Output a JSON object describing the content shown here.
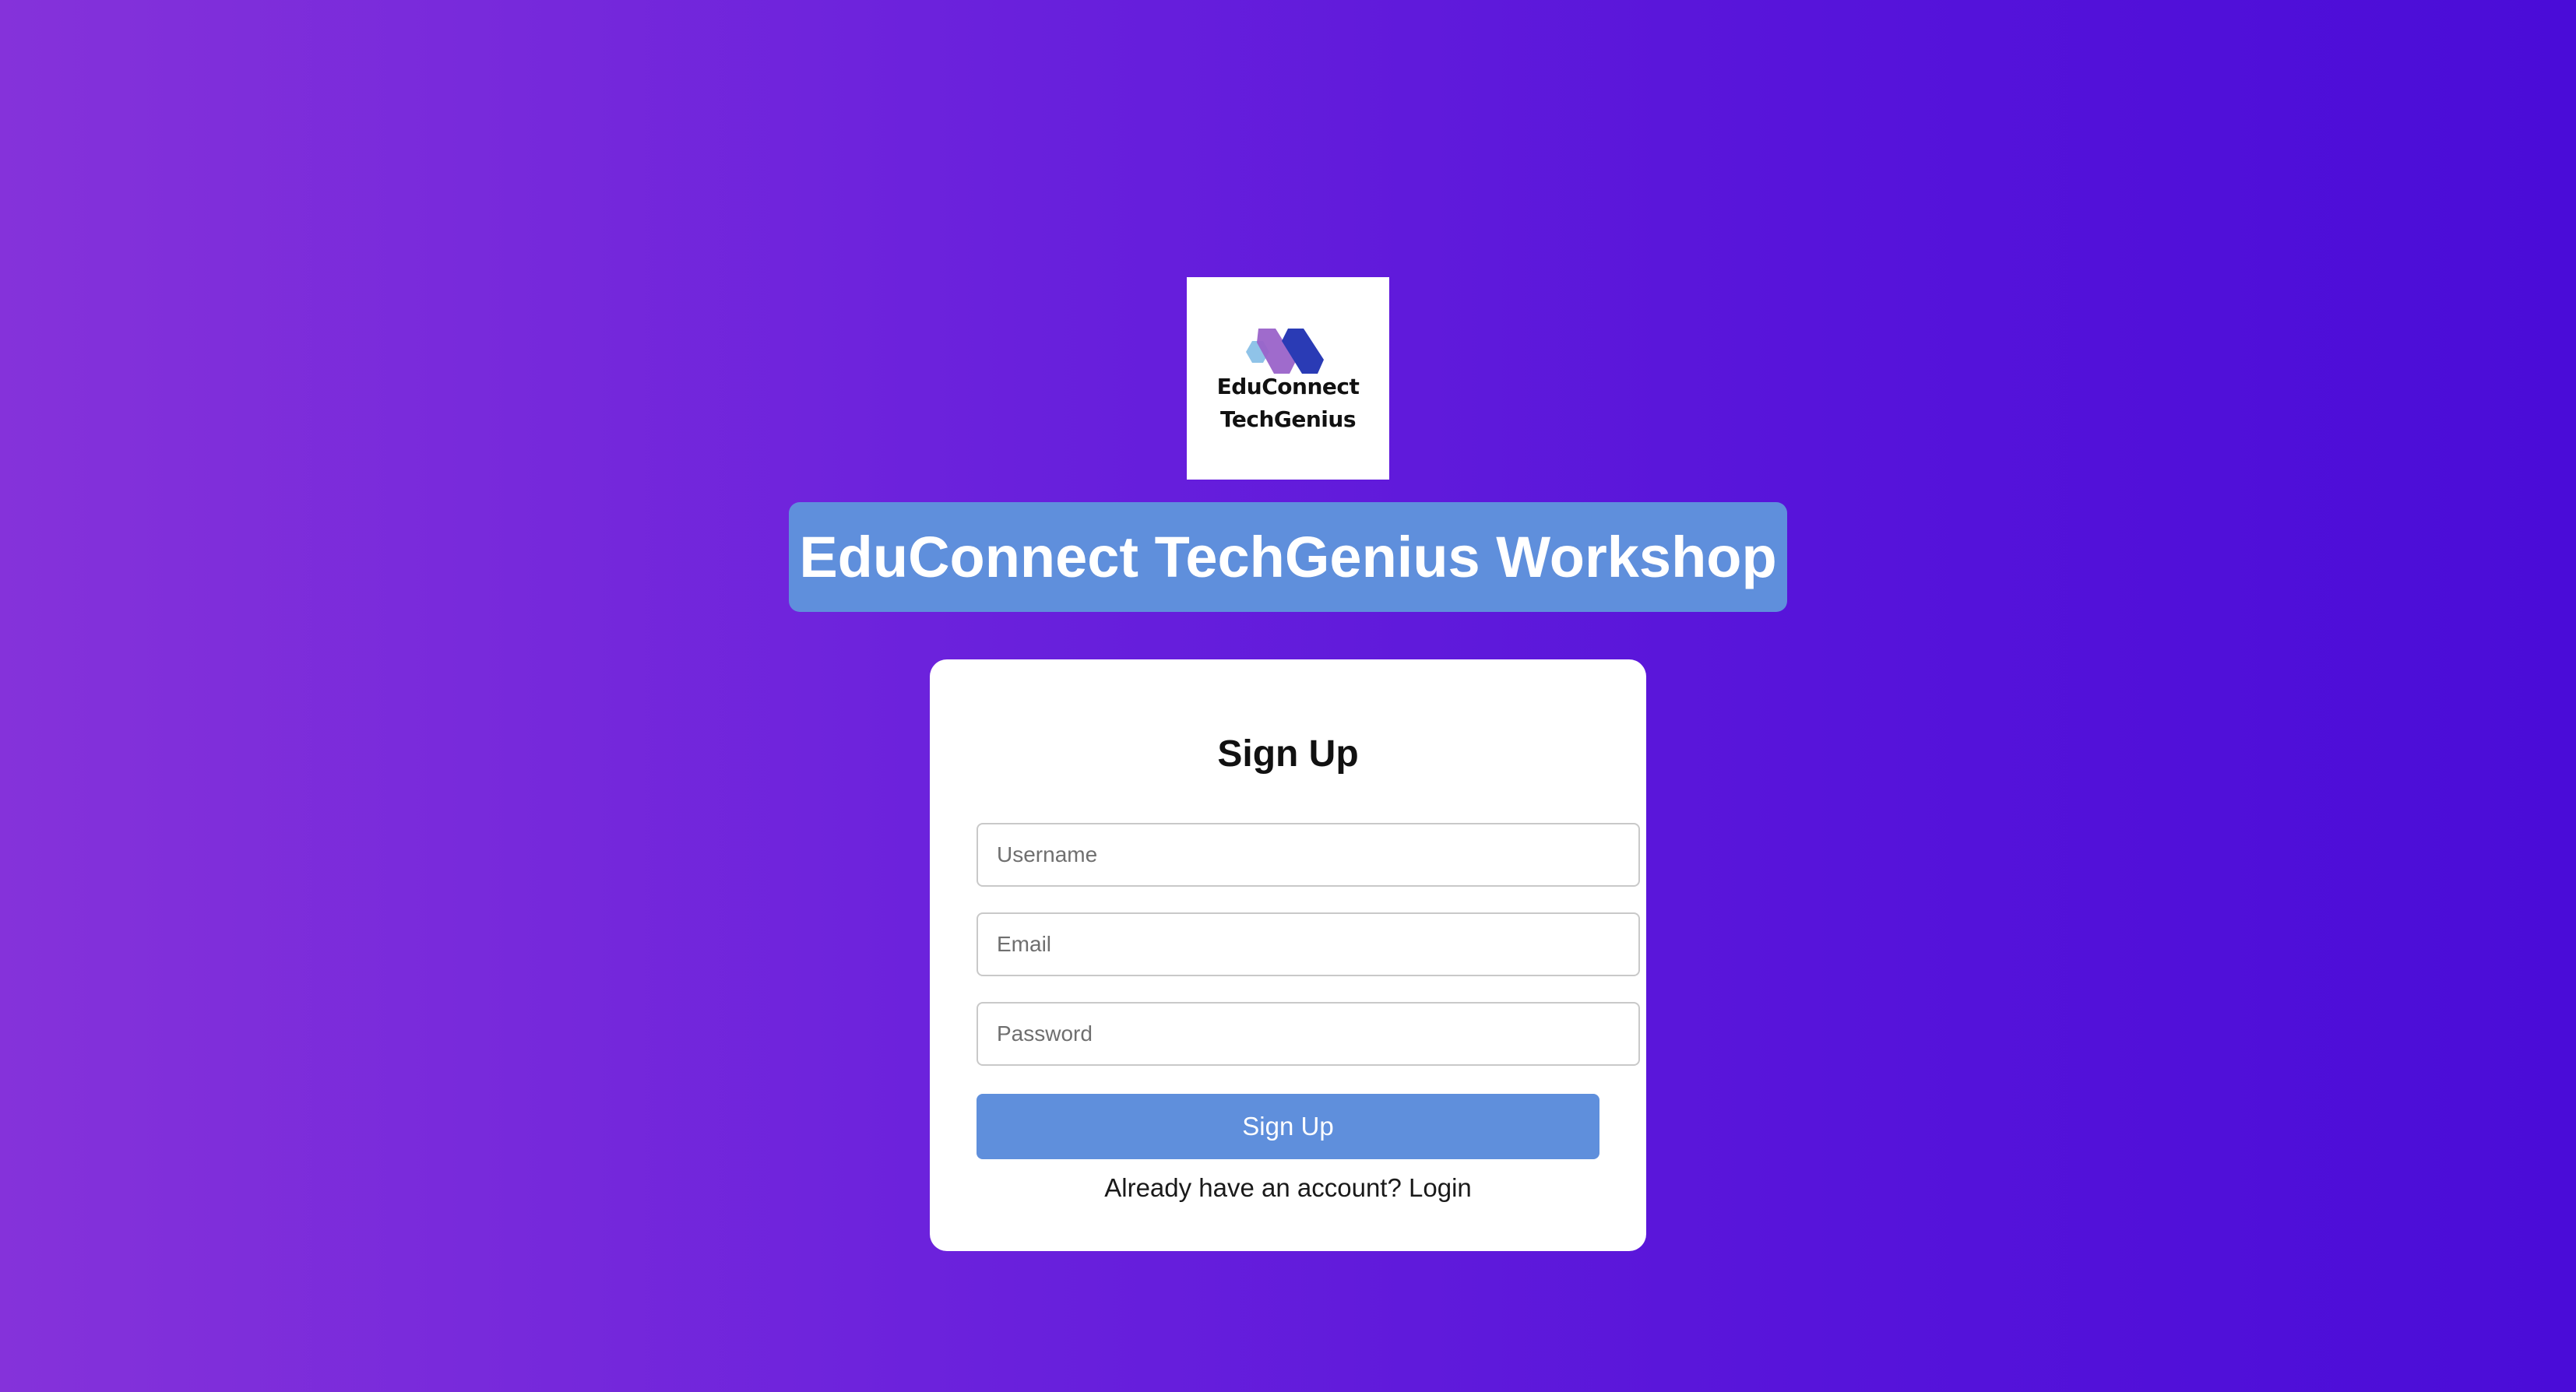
{
  "logo": {
    "line1": "EduConnect",
    "line2": "TechGenius",
    "icon": "hexagon-mark-icon",
    "colors": [
      "#8fc3e8",
      "#9a63c9",
      "#2a3bb5"
    ]
  },
  "header": {
    "title": "EduConnect TechGenius Workshop"
  },
  "form": {
    "title": "Sign Up",
    "username_placeholder": "Username",
    "email_placeholder": "Email",
    "password_placeholder": "Password",
    "submit_label": "Sign Up",
    "login_prompt": "Already have an account?",
    "login_link": "Login"
  },
  "colors": {
    "background_start": "#8532da",
    "background_end": "#4a0cd8",
    "accent": "#5f8fdc",
    "card": "#ffffff"
  }
}
